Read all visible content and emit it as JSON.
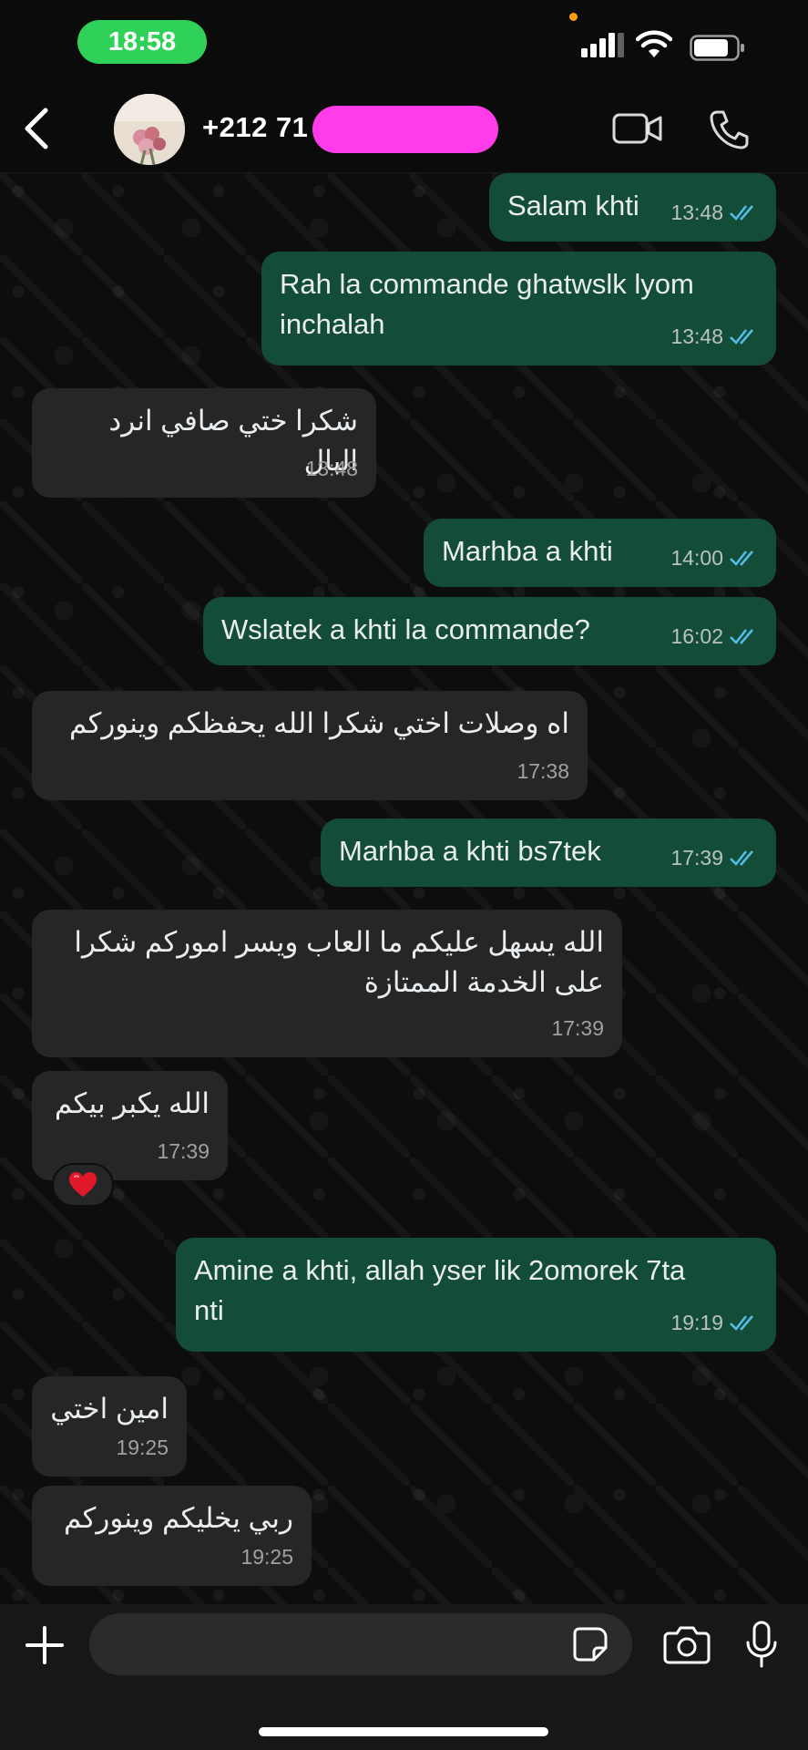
{
  "status_bar": {
    "time": "18:58"
  },
  "header": {
    "contact_name": "+212 71"
  },
  "messages": [
    {
      "dir": "out",
      "text": "Salam khti",
      "time": "13:48",
      "read": true
    },
    {
      "dir": "out",
      "text": "Rah la commande ghatwslk lyom\ninchalah",
      "time": "13:48",
      "read": true
    },
    {
      "dir": "in",
      "text": "شكرا ختي صافي انرد البال",
      "time": "13:48"
    },
    {
      "dir": "out",
      "text": "Marhba a khti",
      "time": "14:00",
      "read": true
    },
    {
      "dir": "out",
      "text": "Wslatek a khti la commande?",
      "time": "16:02",
      "read": true
    },
    {
      "dir": "in",
      "text": "اه وصلات اختي شكرا الله يحفظكم وينوركم",
      "time": "17:38"
    },
    {
      "dir": "out",
      "text": "Marhba a khti bs7tek",
      "time": "17:39",
      "read": true
    },
    {
      "dir": "in",
      "text": "الله يسهل عليكم ما العاب ويسر اموركم شكرا\nعلى الخدمة الممتازة",
      "time": "17:39"
    },
    {
      "dir": "in",
      "text": "الله يكبر بيكم",
      "time": "17:39",
      "reaction": "❤️"
    },
    {
      "dir": "out",
      "text": "Amine a khti, allah yser lik 2omorek 7ta\nnti",
      "time": "19:19",
      "read": true
    },
    {
      "dir": "in",
      "text": "امين اختي",
      "time": "19:25"
    },
    {
      "dir": "in",
      "text": "ربي يخليكم وينوركم",
      "time": "19:25"
    }
  ],
  "composer": {
    "input_value": ""
  },
  "colors": {
    "outgoing": "#144d37",
    "incoming": "#262626",
    "read_ticks": "#53bdeb",
    "status_pill": "#30d158",
    "redaction": "#ff3bea"
  }
}
